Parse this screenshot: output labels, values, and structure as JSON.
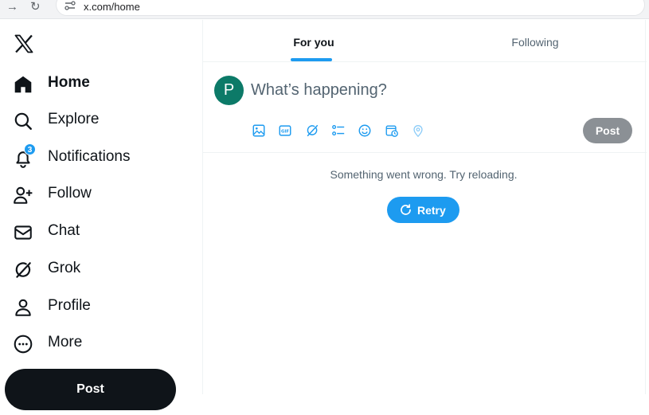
{
  "browser": {
    "url": "x.com/home",
    "back_icon": "arrow-right-icon",
    "reload_icon": "reload-icon"
  },
  "sidebar": {
    "logo": "x-logo",
    "items": [
      {
        "label": "Home",
        "icon": "home-icon",
        "active": true
      },
      {
        "label": "Explore",
        "icon": "search-icon"
      },
      {
        "label": "Notifications",
        "icon": "bell-icon",
        "badge": "3"
      },
      {
        "label": "Follow",
        "icon": "add-user-icon"
      },
      {
        "label": "Chat",
        "icon": "mail-icon"
      },
      {
        "label": "Grok",
        "icon": "grok-icon"
      },
      {
        "label": "Profile",
        "icon": "person-icon"
      },
      {
        "label": "More",
        "icon": "more-circle-icon"
      }
    ],
    "post_label": "Post"
  },
  "tabs": [
    {
      "label": "For you",
      "active": true
    },
    {
      "label": "Following"
    }
  ],
  "compose": {
    "avatar_letter": "P",
    "placeholder": "What’s happening?",
    "tools": [
      "image-icon",
      "gif-icon",
      "grok-icon",
      "poll-icon",
      "emoji-icon",
      "schedule-icon",
      "location-icon"
    ],
    "post_label": "Post"
  },
  "feed": {
    "error_message": "Something went wrong. Try reloading.",
    "retry_label": "Retry"
  },
  "colors": {
    "accent": "#1d9bf0",
    "avatar": "#0c7a68",
    "text_primary": "#0f1419",
    "text_secondary": "#536471"
  }
}
